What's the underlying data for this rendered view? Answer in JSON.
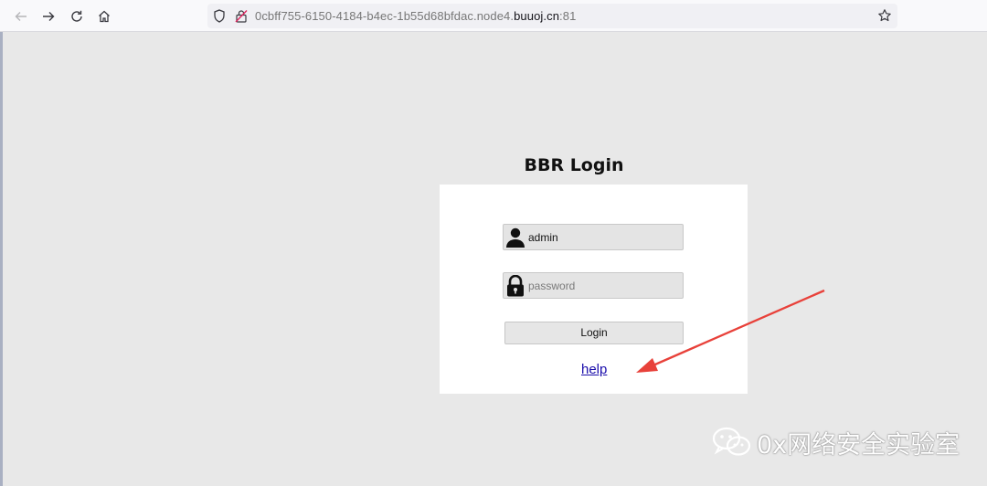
{
  "browser": {
    "url_prefix": "0cbff755-6150-4184-b4ec-1b55d68bfdac.node4.",
    "url_host": "buuoj.cn",
    "url_suffix": ":81",
    "icons": [
      "back-arrow-icon",
      "forward-arrow-icon",
      "reload-icon",
      "home-icon",
      "shield-icon",
      "insecure-lock-icon",
      "bookmark-star-icon"
    ]
  },
  "page": {
    "title": "BBR Login",
    "username_value": "admin",
    "password_placeholder": "password",
    "login_label": "Login",
    "help_label": "help"
  },
  "annotation": {
    "arrow_color": "#e8413a"
  },
  "watermark": {
    "text": "0x网络安全实验室"
  },
  "colors": {
    "page_bg": "#e8e8e8",
    "link": "#1a0dab",
    "box_bg": "#ffffff"
  }
}
